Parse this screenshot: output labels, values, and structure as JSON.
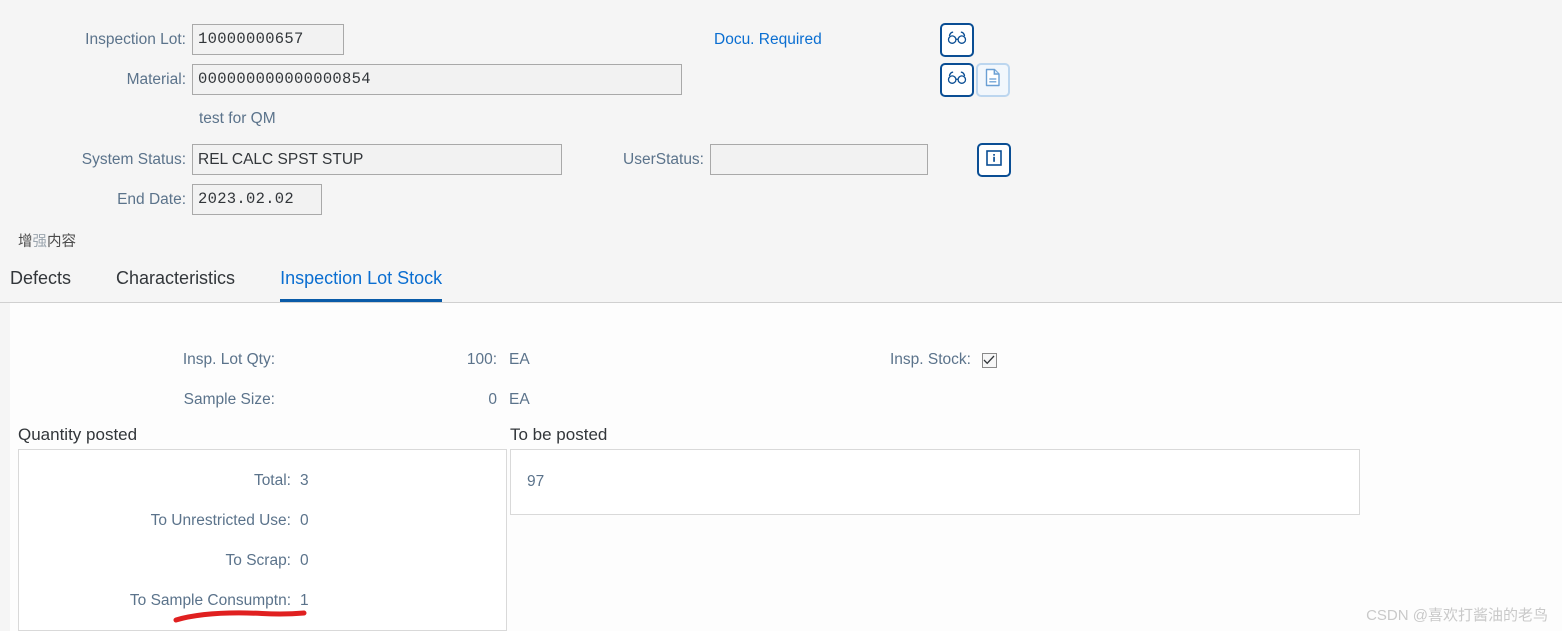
{
  "header": {
    "fields": [
      {
        "label": "Inspection Lot:",
        "value": "10000000657"
      },
      {
        "label": "Material:",
        "value": "000000000000000854"
      },
      {
        "label": "System Status:",
        "value": "REL   CALC SPST STUP"
      },
      {
        "label": "End Date:",
        "value": "2023.02.02"
      },
      {
        "label": "UserStatus:",
        "value": ""
      }
    ],
    "material_description": "test for QM",
    "docu_required_link": "Docu. Required",
    "icons": {
      "display_lot": "glasses-icon",
      "display_material": "glasses-icon",
      "material_doc": "document-icon",
      "status_info": "info-icon"
    }
  },
  "enhanced_content": {
    "prefix": "增",
    "dim": "强",
    "suffix": "内容"
  },
  "tabs": [
    {
      "label": "Defects",
      "active": false
    },
    {
      "label": "Characteristics",
      "active": false
    },
    {
      "label": "Inspection Lot Stock",
      "active": true
    }
  ],
  "stock": {
    "insp_lot_qty_label": "Insp. Lot Qty:",
    "insp_lot_qty_value": "100:",
    "insp_lot_qty_unit": "EA",
    "sample_size_label": "Sample Size:",
    "sample_size_value": "0",
    "sample_size_unit": "EA",
    "insp_stock_label": "Insp. Stock:",
    "insp_stock_checked": true,
    "quantity_posted_title": "Quantity posted",
    "quantity_posted_rows": [
      {
        "label": "Total:",
        "value": "3"
      },
      {
        "label": "To Unrestricted Use:",
        "value": "0"
      },
      {
        "label": "To Scrap:",
        "value": "0"
      },
      {
        "label": "To Sample Consumptn:",
        "value": "1"
      }
    ],
    "to_be_posted_title": "To be posted",
    "to_be_posted_value": "97"
  },
  "watermark": "CSDN @喜欢打酱油的老鸟",
  "colors": {
    "link": "#0a6ed1",
    "tab_active": "#0a6ed1",
    "label": "#5b738b",
    "annotation": "#e02020",
    "page_bg": "#f5f5f5",
    "panel_bg": "#fdfdfd"
  }
}
